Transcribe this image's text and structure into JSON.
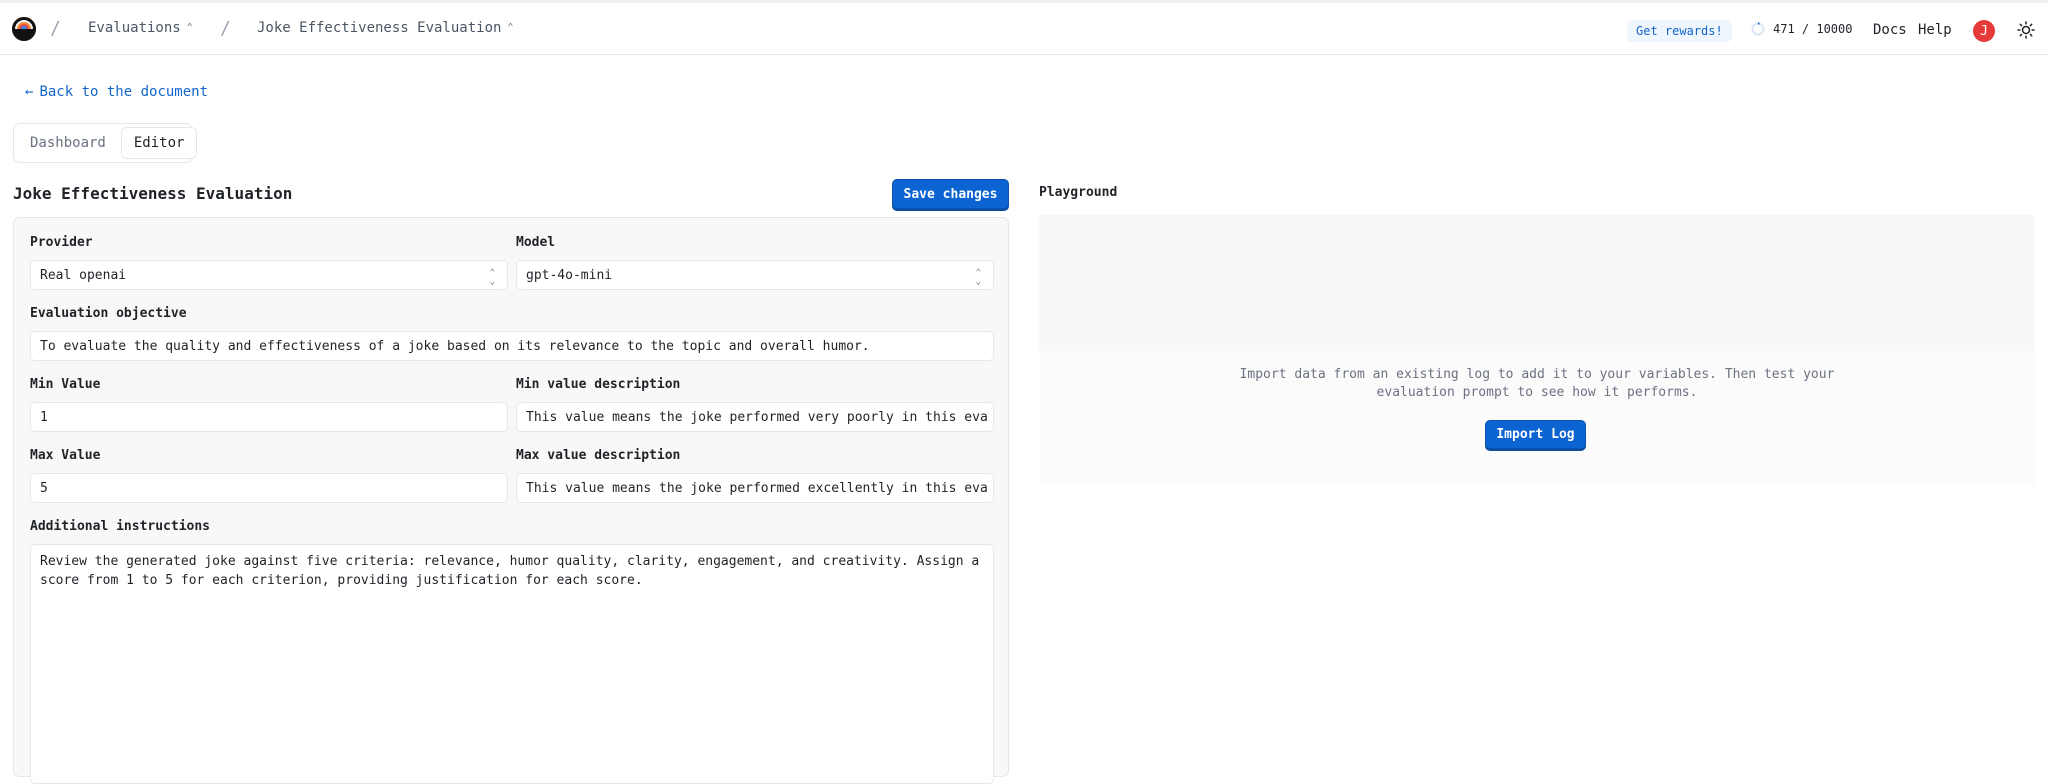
{
  "breadcrumbs": [
    "Evaluations",
    "Joke Effectiveness Evaluation"
  ],
  "header": {
    "rewards_label": "Get rewards!",
    "usage": "471 / 10000",
    "docs": "Docs",
    "help": "Help",
    "avatar_initial": "J"
  },
  "back_link": "Back to the document",
  "tabs": [
    {
      "label": "Dashboard",
      "active": false
    },
    {
      "label": "Editor",
      "active": true
    }
  ],
  "editor": {
    "title": "Joke Effectiveness Evaluation",
    "save_label": "Save changes",
    "provider_label": "Provider",
    "provider_value": "Real openai",
    "model_label": "Model",
    "model_value": "gpt-4o-mini",
    "objective_label": "Evaluation objective",
    "objective_value": "To evaluate the quality and effectiveness of a joke based on its relevance to the topic and overall humor.",
    "min_label": "Min Value",
    "min_value": "1",
    "min_desc_label": "Min value description",
    "min_desc_value": "This value means the joke performed very poorly in this eva",
    "max_label": "Max Value",
    "max_value": "5",
    "max_desc_label": "Max value description",
    "max_desc_value": "This value means the joke performed excellently in this eva",
    "instructions_label": "Additional instructions",
    "instructions_value": "Review the generated joke against five criteria: relevance, humor quality, clarity, engagement, and creativity. Assign a score from 1 to 5 for each criterion, providing justification for each score."
  },
  "playground": {
    "title": "Playground",
    "message": "Import data from an existing log to add it to your variables. Then test your evaluation prompt to see how it performs.",
    "import_label": "Import Log"
  },
  "colors": {
    "accent": "#0b64d1",
    "link": "#1366c9",
    "avatar": "#e5393a"
  }
}
